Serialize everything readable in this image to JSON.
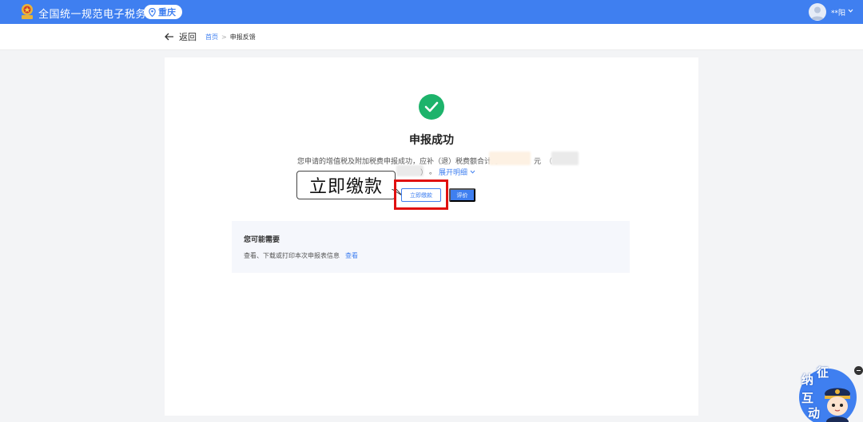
{
  "header": {
    "brand": "全国统一规范电子税务局",
    "region": "重庆",
    "username": "**阳"
  },
  "nav": {
    "back_label": "返回",
    "breadcrumb": [
      "首页",
      "申报反馈"
    ],
    "breadcrumb_sep": ">"
  },
  "result": {
    "title": "申报成功",
    "description": "您申请的增值税及附加税费申报成功，应补（退）税费额合计为",
    "currency": "元",
    "paren_open": "（",
    "paren_close": "）",
    "period": "。",
    "expand_label": "展开明细"
  },
  "actions": {
    "pay_label": "立即缴款",
    "rate_label": "评价"
  },
  "annotation": {
    "callout_text": "立即缴款",
    "highlight_color": "#e01010"
  },
  "suggestion": {
    "title": "您可能需要",
    "text": "查看、下载或打印本次申报表信息",
    "link_label": "查看"
  },
  "widget": {
    "chars": [
      "征",
      "纳",
      "互",
      "动"
    ]
  },
  "colors": {
    "primary": "#3f7ff0",
    "success": "#1db36b"
  }
}
